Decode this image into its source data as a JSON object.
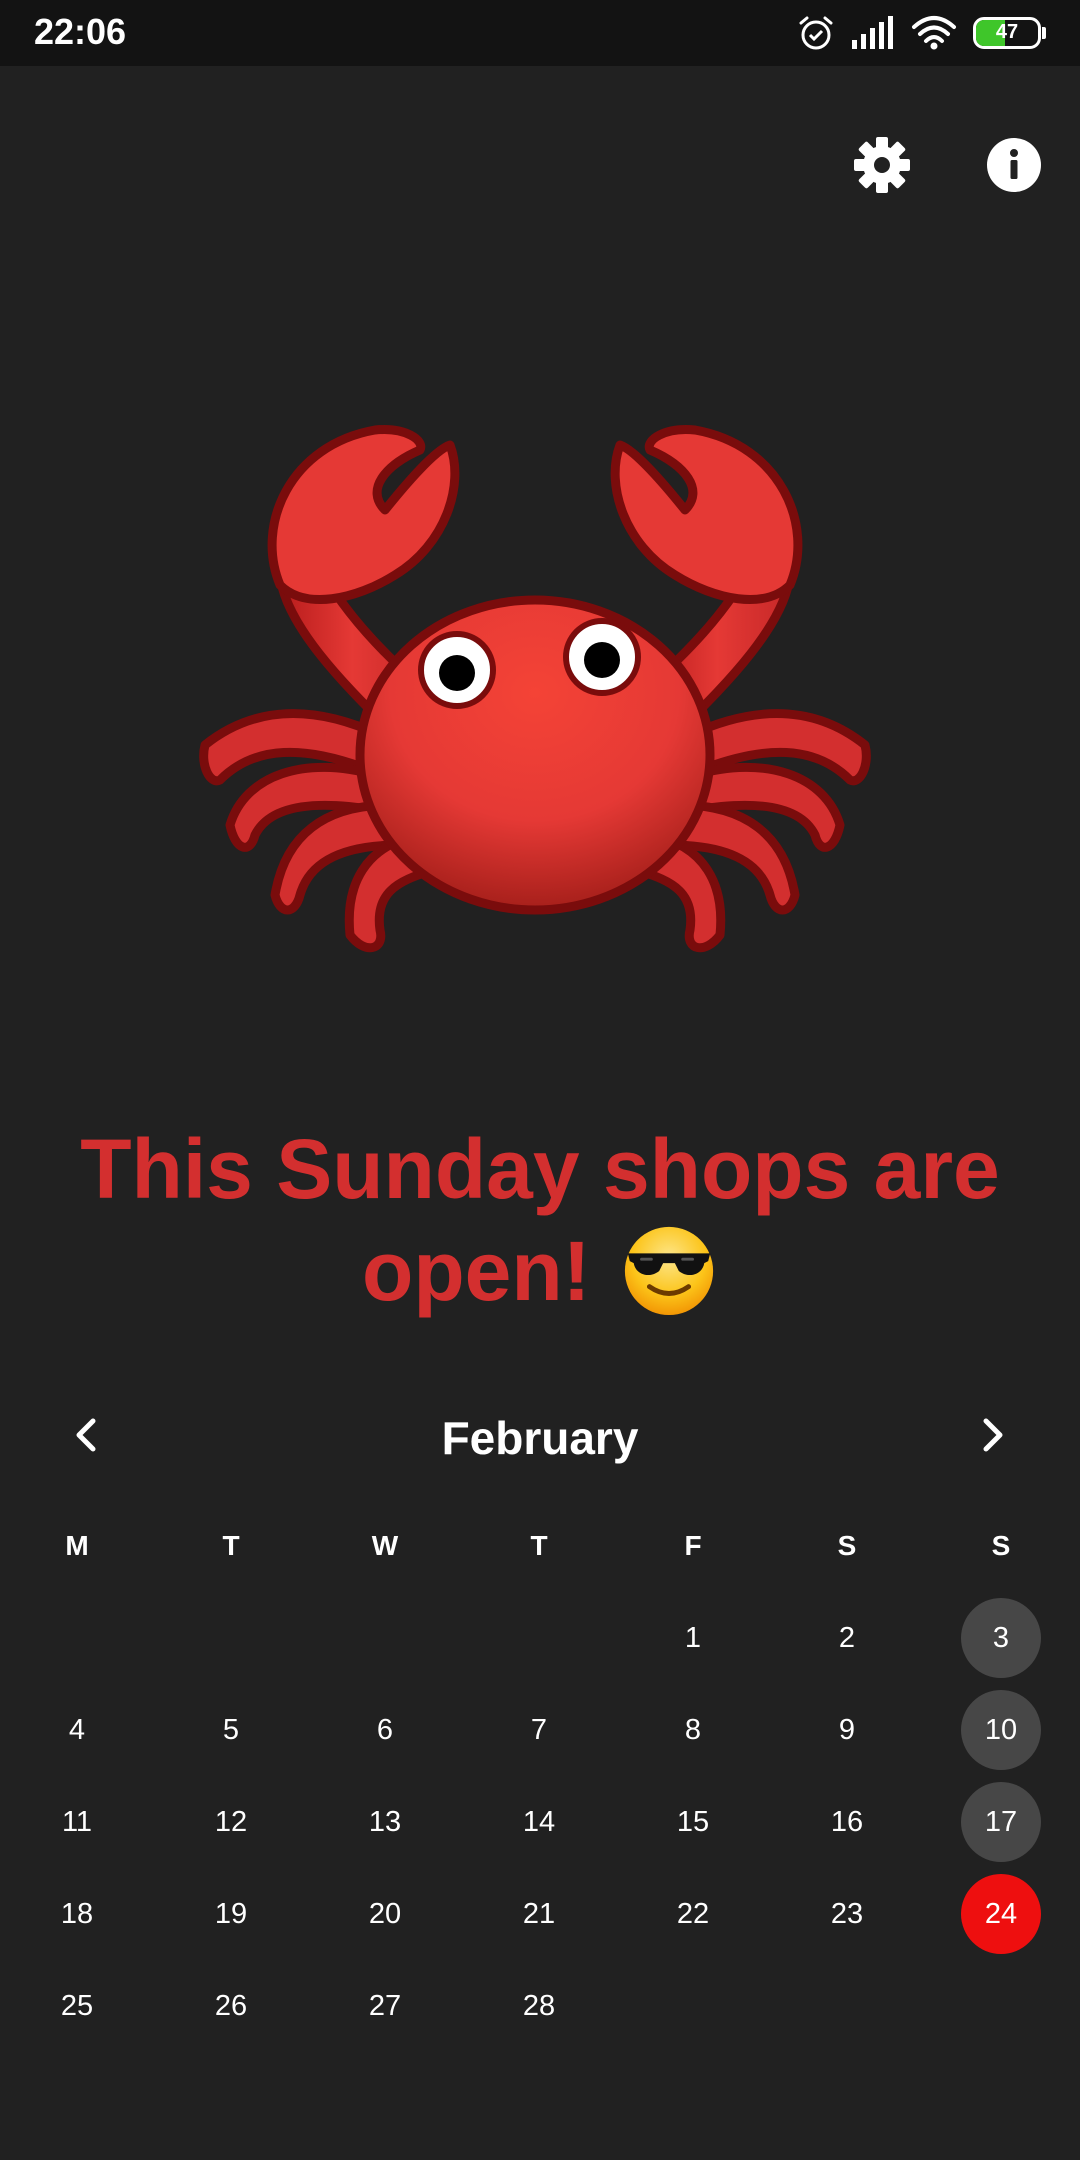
{
  "status_bar": {
    "time": "22:06",
    "battery_level": "47",
    "icons": [
      "alarm-icon",
      "signal-icon",
      "wifi-icon",
      "battery-icon"
    ]
  },
  "toolbar": {
    "icons": [
      "gear-icon",
      "info-icon"
    ]
  },
  "mascot": {
    "icon": "crab-icon"
  },
  "headline": {
    "text": "This Sunday shops are open!",
    "emoji": "smiling-face-with-sunglasses-icon",
    "color": "#d32f2f"
  },
  "calendar": {
    "month": "February",
    "nav_icons": [
      "chevron-left-icon",
      "chevron-right-icon"
    ],
    "weekdays": [
      "M",
      "T",
      "W",
      "T",
      "F",
      "S",
      "S"
    ],
    "weeks": [
      [
        "",
        "",
        "",
        "",
        "1",
        "2",
        "3"
      ],
      [
        "4",
        "5",
        "6",
        "7",
        "8",
        "9",
        "10"
      ],
      [
        "11",
        "12",
        "13",
        "14",
        "15",
        "16",
        "17"
      ],
      [
        "18",
        "19",
        "20",
        "21",
        "22",
        "23",
        "24"
      ],
      [
        "25",
        "26",
        "27",
        "28",
        "",
        "",
        ""
      ]
    ],
    "past_sundays": [
      "3",
      "10",
      "17"
    ],
    "open_sunday": "24",
    "colors": {
      "past_sunday": "#474747",
      "open_sunday": "#ee0f0f"
    }
  }
}
